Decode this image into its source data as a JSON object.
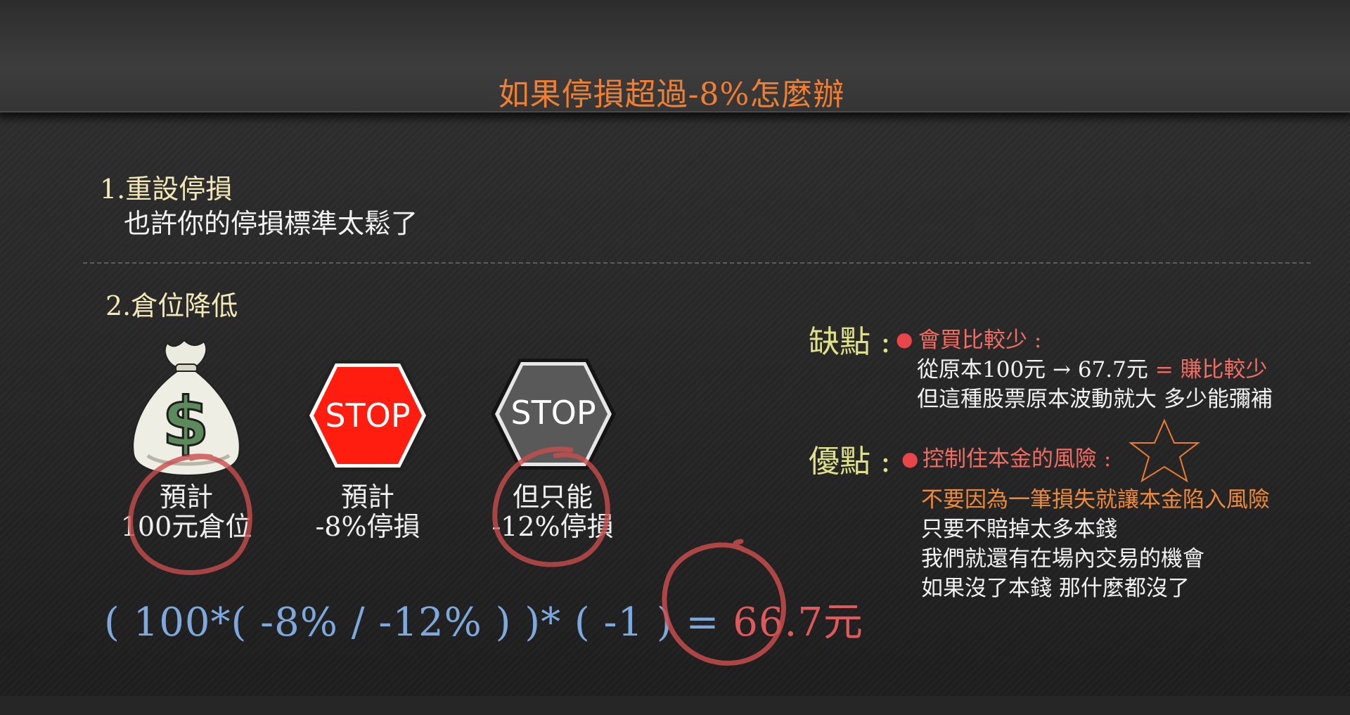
{
  "title": "如果停損超過-8%怎麼辦",
  "section1": {
    "heading": "1.重設停損",
    "text": "也許你的停損標準太鬆了"
  },
  "section2": {
    "heading": "2.倉位降低",
    "items": [
      {
        "icon": "money-bag-icon",
        "line1": "預計",
        "line2": "100元倉位"
      },
      {
        "icon": "red-stop-sign-icon",
        "sign": "STOP",
        "line1": "預計",
        "line2": "-8%停損"
      },
      {
        "icon": "gray-stop-sign-icon",
        "sign": "STOP",
        "line1": "但只能",
        "line2": "-12%停損"
      }
    ],
    "formula": {
      "expression": "( 100*( -8% / -12% ) )* ( -1 ) = ",
      "result": "66.7元"
    }
  },
  "cons": {
    "label": "缺點 :",
    "bullet": "●",
    "heading": "會買比較少 :",
    "line1_a": "從原本100元 → 67.7元",
    "line1_b": " = 賺比較少",
    "line2": "但這種股票原本波動就大 多少能彌補"
  },
  "pros": {
    "label": "優點 :",
    "bullet": "●",
    "heading": "控制住本金的風險 :",
    "lines": [
      "不要因為一筆損失就讓本金陷入風險",
      "只要不賠掉太多本錢",
      "我們就還有在場內交易的機會",
      "如果沒了本錢 那什麼都沒了"
    ]
  },
  "colors": {
    "title": "#ef7f34",
    "heading": "#f3e9b8",
    "label": "#dfe08a",
    "highlight_red": "#f26d63",
    "highlight_orange": "#ee8a3c",
    "formula": "#7fa9dc",
    "stop_red": "#ff1d0f",
    "stop_gray": "#595959"
  }
}
